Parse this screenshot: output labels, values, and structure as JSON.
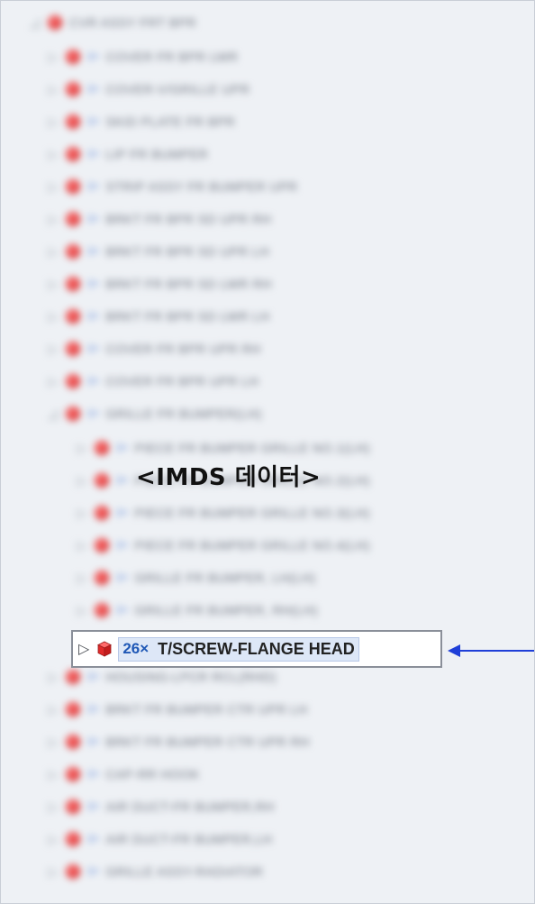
{
  "annotation": {
    "title": "<IMDS 데이터>"
  },
  "highlighted_item": {
    "expander": "▷",
    "count": "26×",
    "label": "T/SCREW-FLANGE HEAD",
    "icon": "red-cube-icon"
  },
  "tree": {
    "root_label": "CVR ASSY FRT BPR",
    "items": [
      {
        "label": "COVER FR BPR LWR"
      },
      {
        "label": "COVER-V/GRILLE UPR"
      },
      {
        "label": "SKID PLATE FR BPR"
      },
      {
        "label": "LIP FR BUMPER"
      },
      {
        "label": "STRIP ASSY FR BUMPER UPR"
      },
      {
        "label": "BRKT FR BPR SD UPR RH"
      },
      {
        "label": "BRKT FR BPR SD UPR LH"
      },
      {
        "label": "BRKT FR BPR SD LWR RH"
      },
      {
        "label": "BRKT FR BPR SD LWR LH"
      },
      {
        "label": "COVER FR BPR UPR RH"
      },
      {
        "label": "COVER FR BPR UPR LH"
      },
      {
        "label": "GRILLE FR BUMPER(LH)"
      },
      {
        "label": "PIECE FR BUMPER GRILLE NO.1(LH)"
      },
      {
        "label": "PIECE FR BUMPER GRILLE NO.2(LH)"
      },
      {
        "label": "PIECE FR BUMPER GRILLE NO.3(LH)"
      },
      {
        "label": "PIECE FR BUMPER GRILLE NO.4(LH)"
      },
      {
        "label": "GRILLE FR BUMPER, LH(LH)"
      },
      {
        "label": "GRILLE FR BUMPER, RH(LH)"
      },
      {
        "label": "HOUSING-LPCR RCL(RHD)"
      },
      {
        "label": "BRKT FR BUMPER CTR UPR LH"
      },
      {
        "label": "BRKT FR BUMPER CTR UPR RH"
      },
      {
        "label": "CAP-RR HOOK"
      },
      {
        "label": "AIR DUCT-FR BUMPER,RH"
      },
      {
        "label": "AIR DUCT-FR BUMPER,LH"
      },
      {
        "label": "GRILLE ASSY-RADIATOR"
      }
    ]
  },
  "colors": {
    "arrow": "#1f3fd8",
    "part_icon": "#e23a3a",
    "highlight_bg": "#dde7f7",
    "count_text": "#1f58b6"
  }
}
